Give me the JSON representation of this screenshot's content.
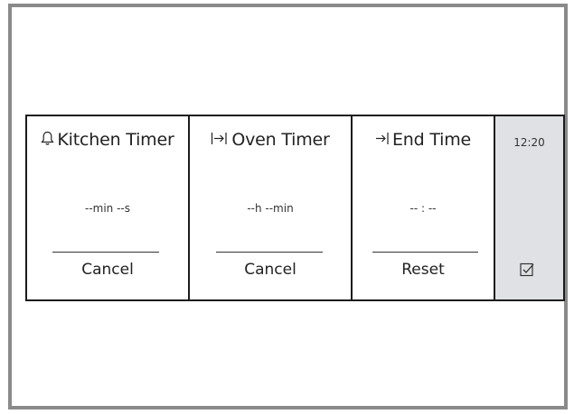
{
  "timers": [
    {
      "id": "kitchen",
      "title": "Kitchen Timer",
      "value": "--min --s",
      "action": "Cancel",
      "icon": "bell-icon"
    },
    {
      "id": "oven",
      "title": "Oven Timer",
      "value": "--h --min",
      "action": "Cancel",
      "icon": "oven-timer-icon"
    },
    {
      "id": "end",
      "title": "End Time",
      "value": "-- : --",
      "action": "Reset",
      "icon": "end-time-icon"
    }
  ],
  "sidebar": {
    "clock": "12:20",
    "confirm_icon": "checkbox-check-icon"
  },
  "colors": {
    "frame": "#8a8a8a",
    "sidebar": "#dfe1e4",
    "border": "#1c1c1c"
  }
}
